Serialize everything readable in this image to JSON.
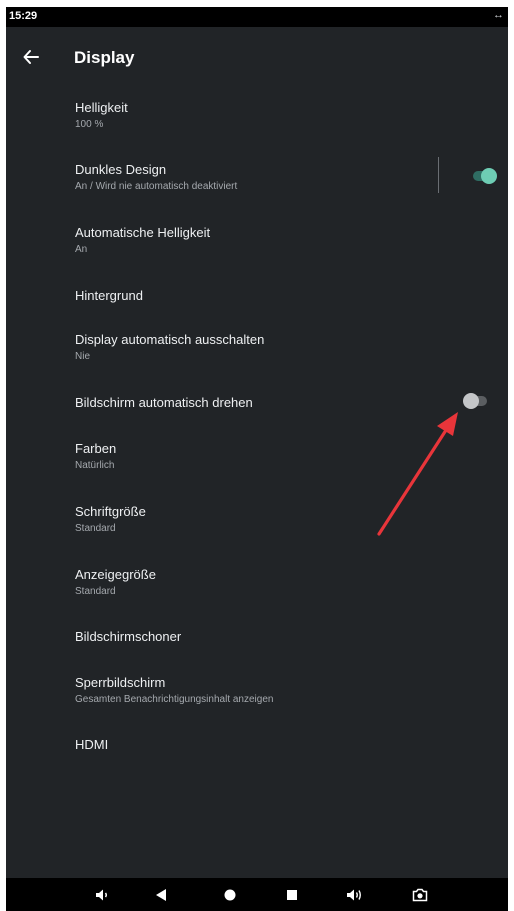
{
  "status_bar": {
    "time": "15:29",
    "rotate_glyph": "↔"
  },
  "toolbar": {
    "title": "Display",
    "back_icon": "arrow-back-icon"
  },
  "settings": [
    {
      "title": "Helligkeit",
      "summary": "100 %"
    },
    {
      "title": "Dunkles Design",
      "summary": "An / Wird nie automatisch deaktiviert",
      "switch_on": true
    },
    {
      "title": "Automatische Helligkeit",
      "summary": "An"
    },
    {
      "title": "Hintergrund",
      "summary": ""
    },
    {
      "title": "Display automatisch ausschalten",
      "summary": "Nie"
    },
    {
      "title": "Bildschirm automatisch drehen",
      "summary": "",
      "switch_on": false
    },
    {
      "title": "Farben",
      "summary": "Natürlich"
    },
    {
      "title": "Schriftgröße",
      "summary": "Standard"
    },
    {
      "title": "Anzeigegröße",
      "summary": "Standard"
    },
    {
      "title": "Bildschirmschoner",
      "summary": ""
    },
    {
      "title": "Sperrbildschirm",
      "summary": "Gesamten Benachrichtigungsinhalt anzeigen"
    },
    {
      "title": "HDMI",
      "summary": ""
    }
  ],
  "nav_bar": [
    "volume-down-icon",
    "back-triangle-icon",
    "home-circle-icon",
    "recents-square-icon",
    "volume-up-icon",
    "screenshot-camera-icon"
  ],
  "colors": {
    "background": "#212427",
    "accent": "#6ecdb4",
    "annotation_arrow": "#e8353a"
  }
}
